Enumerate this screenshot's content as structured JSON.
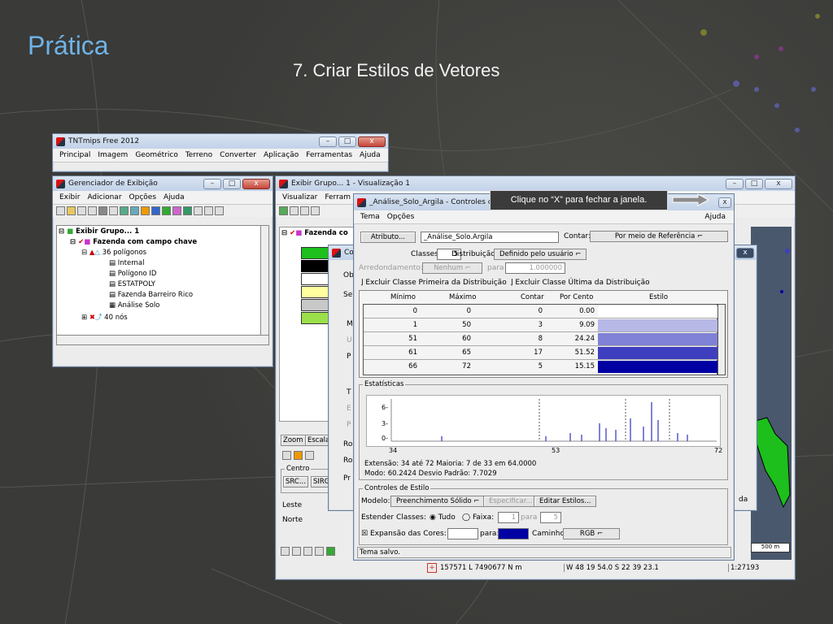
{
  "slide": {
    "title": "Prática",
    "subtitle": "7. Criar Estilos de Vetores",
    "callout": "Clique no “X” para fechar a janela."
  },
  "main_window": {
    "title": "TNTmips Free 2012",
    "menu": [
      "Principal",
      "Imagem",
      "Geométrico",
      "Terreno",
      "Converter",
      "Aplicação",
      "Ferramentas",
      "Ajuda"
    ]
  },
  "display_manager": {
    "title": "Gerenciador de Exibição",
    "menu": [
      "Exibir",
      "Adicionar",
      "Opções",
      "Ajuda"
    ],
    "tree": [
      "Exibir Grupo... 1",
      "Fazenda com campo chave",
      "36 polígonos",
      "Internal",
      "Polígono ID",
      "ESTATPOLY",
      "Fazenda Barreiro Rico",
      "Análise Solo",
      "40 nós"
    ]
  },
  "view_window": {
    "title": "Exibir Grupo... 1 - Visualização 1",
    "menu": [
      "Visualizar",
      "Ferram"
    ],
    "legend_layer": "Fazenda co",
    "tabs": [
      "Zoom",
      "Escala"
    ],
    "labels": {
      "centro": "Centro",
      "src": "SRC...",
      "sirg": "SIRG",
      "leste": "Leste",
      "norte": "Norte"
    },
    "status": {
      "coords": "157571 L 7490677 N m",
      "geo": "W 48 19 54.0  S 22 39 23.1",
      "scale": "1:27193",
      "scalebar": "500 m"
    }
  },
  "behind_dialog": {
    "rows": [
      "Ob",
      "Se",
      "M",
      "U",
      "P",
      "T",
      "E",
      "P",
      "Ro",
      "Ro",
      "Pr"
    ],
    "side_label": "da"
  },
  "style_dialog": {
    "title": "_Análise_Solo_Argila - Controles de E",
    "menu": [
      "Tema",
      "Opções"
    ],
    "help": "Ajuda",
    "atributo_button": "Atributo...",
    "atributo_value": "_Análise_Solo.Argila",
    "contar_label": "Contar:",
    "contar_value": "Por meio de Referência",
    "classes_label": "Classes:",
    "classes_value": "5",
    "distribuicao_label": "Distribuição:",
    "distribuicao_value": "Definido pelo usuário",
    "arredondamento_label": "Arredondamento:",
    "arredondamento_value": "Nenhum",
    "para_label": "para",
    "para_value": "1.000000",
    "excluir_primeira": "Excluir Classe Primeira da Distribuição",
    "excluir_ultima": "Excluir Classe Última da Distribuição",
    "columns": [
      "Mínimo",
      "Máximo",
      "Contar",
      "Por Cento",
      "Estilo"
    ],
    "rows": [
      {
        "min": "0",
        "max": "0",
        "count": "0",
        "pct": "0.00",
        "color": "#ffffff"
      },
      {
        "min": "1",
        "max": "50",
        "count": "3",
        "pct": "9.09",
        "color": "#b7b8e6"
      },
      {
        "min": "51",
        "max": "60",
        "count": "8",
        "pct": "24.24",
        "color": "#7f81d6"
      },
      {
        "min": "61",
        "max": "65",
        "count": "17",
        "pct": "51.52",
        "color": "#3d3fbf"
      },
      {
        "min": "66",
        "max": "72",
        "count": "5",
        "pct": "15.15",
        "color": "#0000a3"
      }
    ],
    "estatisticas_label": "Estatísticas",
    "hist_y_ticks": [
      "6-",
      "3-",
      "0-"
    ],
    "hist_x_ticks": [
      "34",
      "53",
      "72"
    ],
    "stats_line1": "Extensão: 34 até 72  Maioria: 7 de 33 em 64.0000",
    "stats_line2": "Modo: 60.2424  Desvio Padrão: 7.7029",
    "controles_label": "Controles de Estilo",
    "modelo_label": "Modelo:",
    "modelo_value": "Preenchimento Sólido",
    "especificar": "Especificar...",
    "editar": "Editar Estilos...",
    "estender_label": "Estender Classes:",
    "tudo": "Tudo",
    "faixa": "Faixa:",
    "faixa_from": "1",
    "faixa_para": "para",
    "faixa_to": "5",
    "expansao": "Expansão das Cores:",
    "expansao_para": "para:",
    "caminho_label": "Caminho:",
    "caminho_value": "RGB",
    "color_from": "#ffffff",
    "color_to": "#0000a3",
    "status": "Tema salvo."
  }
}
